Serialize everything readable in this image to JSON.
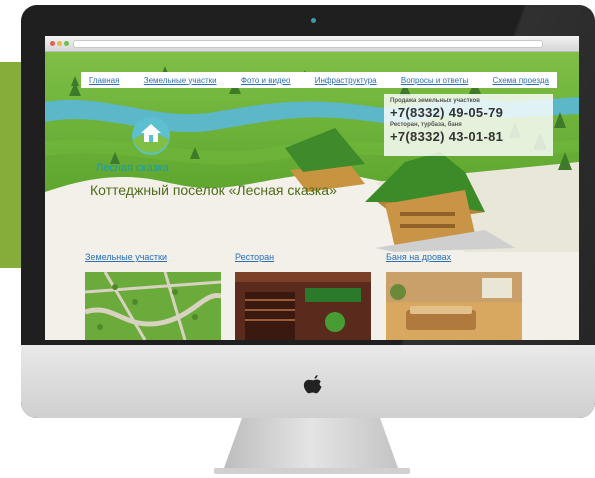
{
  "side_banner": {
    "text_top": "",
    "text_bottom": ""
  },
  "nav": {
    "items": [
      {
        "label": "Главная"
      },
      {
        "label": "Земельные участки"
      },
      {
        "label": "Фото и видео"
      },
      {
        "label": "Инфраструктура"
      },
      {
        "label": "Вопросы и ответы"
      },
      {
        "label": "Схема проезда"
      }
    ]
  },
  "contacts": {
    "label1": "Продажа земельных участков",
    "phone1": "+7(8332) 49-05-79",
    "label2": "Ресторан, турбаза, баня",
    "phone2": "+7(8332) 43-01-81"
  },
  "logo": {
    "text": "Лесная сказка"
  },
  "headline": "Коттеджный поселок «Лесная сказка»",
  "sections": [
    {
      "title": "Земельные участки"
    },
    {
      "title": "Ресторан"
    },
    {
      "title": "Баня на дровах"
    }
  ],
  "colors": {
    "banner_green": "#86ac3a",
    "link_blue": "#2a6fb8",
    "logo_teal": "#1d9ab0",
    "headline_green": "#4d6b1a"
  }
}
